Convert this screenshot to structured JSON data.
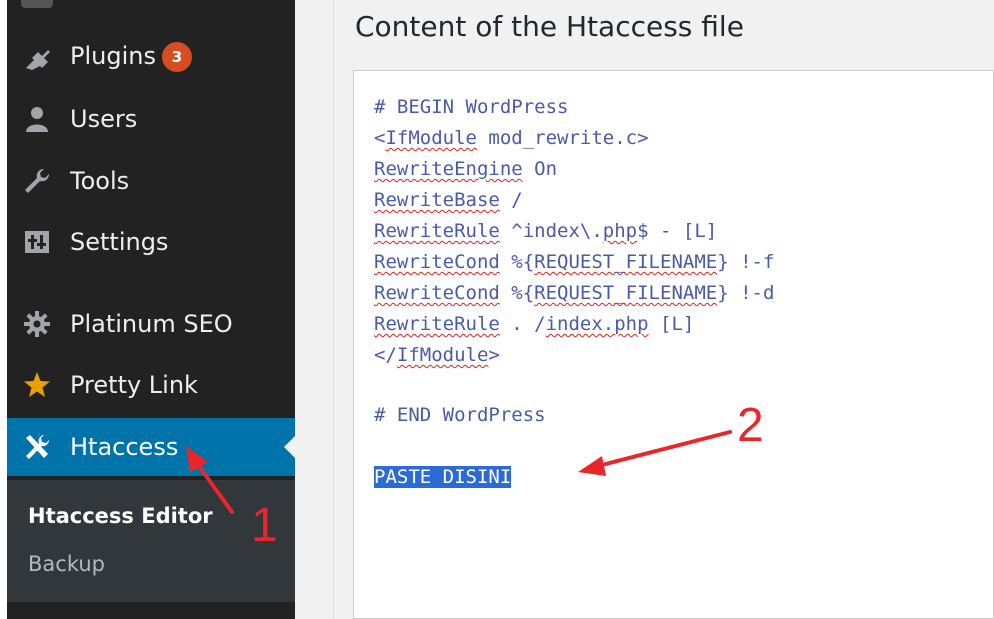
{
  "sidebar": {
    "items": [
      {
        "label": "Plugins",
        "icon": "plugin-icon",
        "badge": "3"
      },
      {
        "label": "Users",
        "icon": "users-icon"
      },
      {
        "label": "Tools",
        "icon": "wrench-icon"
      },
      {
        "label": "Settings",
        "icon": "settings-sliders-icon"
      },
      {
        "label": "Platinum SEO",
        "icon": "gear-icon"
      },
      {
        "label": "Pretty Link",
        "icon": "star-icon"
      },
      {
        "label": "Htaccess",
        "icon": "tools-icon",
        "active": true
      }
    ],
    "submenu": [
      {
        "label": "Htaccess Editor",
        "current": true
      },
      {
        "label": "Backup"
      }
    ]
  },
  "main": {
    "title": "Content of the Htaccess file",
    "code_lines": [
      "# BEGIN WordPress",
      "<IfModule mod_rewrite.c>",
      "RewriteEngine On",
      "RewriteBase /",
      "RewriteRule ^index\\.php$ - [L]",
      "RewriteCond %{REQUEST_FILENAME} !-f",
      "RewriteCond %{REQUEST_FILENAME} !-d",
      "RewriteRule . /index.php [L]",
      "</IfModule>",
      "",
      "# END WordPress",
      "",
      "PASTE DISINI"
    ]
  },
  "annotations": {
    "step1": "1",
    "step2": "2",
    "color": "#e8262b"
  },
  "colors": {
    "sidebar_bg": "#222222",
    "active_bg": "#0073aa",
    "badge": "#d54e21",
    "code_text": "#4a5aa8",
    "selection": "#2a6bd6"
  }
}
